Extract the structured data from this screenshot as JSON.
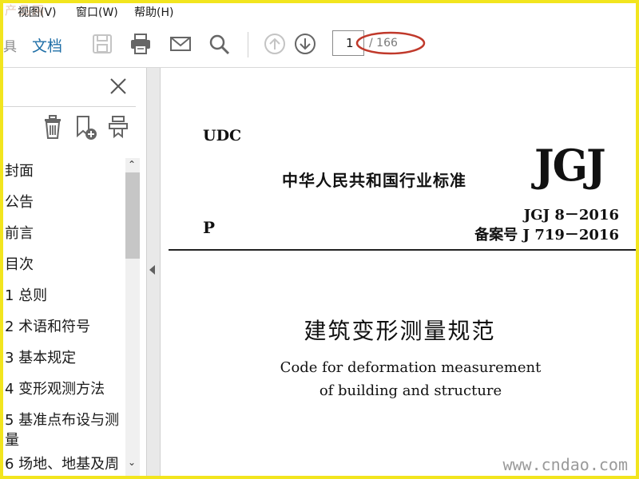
{
  "menubar": {
    "watermark": "产品网",
    "items": [
      "视图(V)",
      "窗口(W)",
      "帮助(H)"
    ]
  },
  "toolbar": {
    "cut_tab": "具",
    "doc_tab": "文档",
    "icons": [
      "save-icon",
      "print-icon",
      "mail-icon",
      "search-icon",
      "page-up-icon",
      "page-down-icon"
    ],
    "current_page": "1",
    "page_total": "/ 166",
    "highlight_color": "#c0392b"
  },
  "sidebar": {
    "icons": [
      "trash-icon",
      "add-bookmark-icon",
      "expand-icon"
    ],
    "items": [
      "封面",
      "公告",
      "前言",
      "目次",
      "1 总则",
      "2 术语和符号",
      "3 基本规定",
      "4 变形观测方法",
      "5 基准点布设与测",
      "量",
      "6 场地、地基及周"
    ]
  },
  "document": {
    "udc": "UDC",
    "std_title": "中华人民共和国行业标准",
    "logo": "JGJ",
    "p_mark": "P",
    "code_no": "JGJ 8－2016",
    "filing_no": "备案号 J 719－2016",
    "title_cn": "建筑变形测量规范",
    "title_en_line1": "Code for deformation measurement",
    "title_en_line2": "of building and structure"
  },
  "watermark": {
    "site": "www.cndao.com"
  },
  "colors": {
    "frame": "#f2e51e",
    "accent": "#1f6fa7"
  }
}
